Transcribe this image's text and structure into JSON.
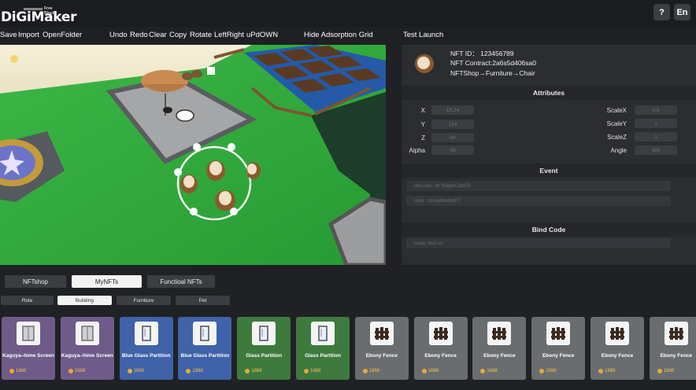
{
  "app": {
    "logo_text": "DiGiMaker",
    "logo_sub": "Free Block",
    "help_label": "?",
    "lang_label": "En"
  },
  "toolbar": {
    "items": [
      "Save",
      "Import",
      "OpenFolder",
      "Undo",
      "Redo",
      "Clear",
      "Copy",
      "Rotate",
      "LeftRight",
      "uPdOWN",
      "Hide Adsorption Grid",
      "Test Launch"
    ]
  },
  "nft": {
    "id_line": "NFT ID： 123456789",
    "contract_line": "NFT Contract:2a6s5d406sa0",
    "shop_line": "NFTShop→Furniture→Chair"
  },
  "attributes": {
    "title": "Attributes",
    "left": [
      {
        "label": "X",
        "value": "10.24"
      },
      {
        "label": "Y",
        "value": "124"
      },
      {
        "label": "Z",
        "value": "84"
      },
      {
        "label": "Alpha",
        "value": "58"
      }
    ],
    "right": [
      {
        "label": "ScaleX",
        "value": "0.5"
      },
      {
        "label": "ScaleY",
        "value": "1"
      },
      {
        "label": "ScaleZ",
        "value": "1"
      },
      {
        "label": "Angle",
        "value": "180"
      }
    ]
  },
  "event": {
    "title": "Event",
    "rows": [
      "onLoad : fn StageCamTo",
      "click : showWebNFT"
    ]
  },
  "bind_code": {
    "title": "Bind Code",
    "value": "code: test us"
  },
  "tabs": {
    "main": [
      "NFTshop",
      "MyNFTs",
      "Functioal NFTs"
    ],
    "active_main": "MyNFTs",
    "sub": [
      "Role",
      "Building",
      "Furniture",
      "Pet"
    ],
    "active_sub": "Building"
  },
  "items": [
    {
      "name": "Kaguya–hime Screen",
      "price": "1888",
      "color": "#6e5b8a",
      "icon": "screen-icon"
    },
    {
      "name": "Kaguya–hime Screen",
      "price": "1888",
      "color": "#6e5b8a",
      "icon": "screen-icon"
    },
    {
      "name": "Blue Glass Partition",
      "price": "1888",
      "color": "#3f62a8",
      "icon": "glass-partition-icon"
    },
    {
      "name": "Blue Glass Partition",
      "price": "1888",
      "color": "#3f62a8",
      "icon": "glass-partition-icon"
    },
    {
      "name": "Glass Partition",
      "price": "1888",
      "color": "#3e7a3e",
      "icon": "glass-partition-icon"
    },
    {
      "name": "Glass Partition",
      "price": "1888",
      "color": "#3e7a3e",
      "icon": "glass-partition-icon"
    },
    {
      "name": "Ebony Fence",
      "price": "1888",
      "color": "#6a6d70",
      "icon": "fence-icon"
    },
    {
      "name": "Ebony Fence",
      "price": "1888",
      "color": "#6a6d70",
      "icon": "fence-icon"
    },
    {
      "name": "Ebony Fence",
      "price": "1888",
      "color": "#6a6d70",
      "icon": "fence-icon"
    },
    {
      "name": "Ebony Fence",
      "price": "1888",
      "color": "#6a6d70",
      "icon": "fence-icon"
    },
    {
      "name": "Ebony Fence",
      "price": "1888",
      "color": "#6a6d70",
      "icon": "fence-icon"
    },
    {
      "name": "Ebony Fence",
      "price": "1888",
      "color": "#6a6d70",
      "icon": "fence-icon"
    }
  ]
}
